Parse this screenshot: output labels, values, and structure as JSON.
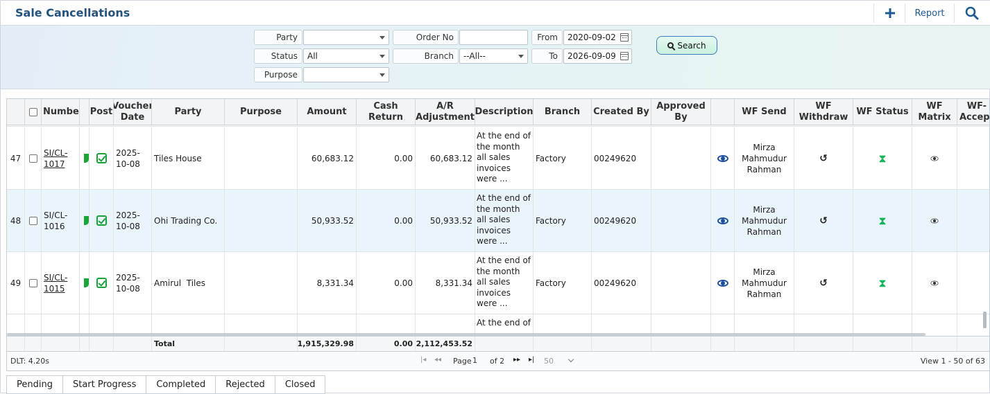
{
  "header": {
    "title": "Sale Cancellations",
    "report_label": "Report"
  },
  "filters": {
    "party_label": "Party",
    "party_value": "",
    "status_label": "Status",
    "status_value": "All",
    "purpose_label": "Purpose",
    "purpose_value": "",
    "order_no_label": "Order No",
    "order_no_value": "",
    "branch_label": "Branch",
    "branch_value": "--All--",
    "from_label": "From",
    "from_value": "2020-09-02",
    "to_label": "To",
    "to_value": "2026-09-09",
    "search_label": "Search"
  },
  "columns": {
    "number": "Number",
    "post": "Post",
    "voucher_date": "Voucher Date",
    "party": "Party",
    "purpose": "Purpose",
    "amount": "Amount",
    "cash_return": "Cash Return",
    "ar_adjustment": "A/R Adjustment",
    "description": "Description",
    "branch": "Branch",
    "created_by": "Created By",
    "approved_by": "Approved By",
    "wf_send": "WF Send",
    "wf_withdraw": "WF Withdraw",
    "wf_status": "WF Status",
    "wf_matrix": "WF Matrix",
    "wf_accept": "WF-Accept"
  },
  "rows": [
    {
      "idx": "47",
      "number": "SI/CL-1017",
      "date": "2025-10-08",
      "party": "Tiles House",
      "purpose": "",
      "amount": "60,683.12",
      "cash_return": "0.00",
      "ar_adjustment": "60,683.12",
      "description": "At the end of the month all sales invoices were ...",
      "branch": "Factory",
      "created_by": "00249620",
      "approved_by": "",
      "wf_send": "Mirza Mahmudur Rahman"
    },
    {
      "idx": "48",
      "number": "SI/CL-1016",
      "date": "2025-10-08",
      "party": "Ohi Trading Co.",
      "purpose": "",
      "amount": "50,933.52",
      "cash_return": "0.00",
      "ar_adjustment": "50,933.52",
      "description": "At the end of the month all sales invoices were ...",
      "branch": "Factory",
      "created_by": "00249620",
      "approved_by": "",
      "wf_send": "Mirza Mahmudur Rahman"
    },
    {
      "idx": "49",
      "number": "SI/CL-1015",
      "date": "2025-10-08",
      "party": "Amirul  Tiles",
      "purpose": "",
      "amount": "8,331.34",
      "cash_return": "0.00",
      "ar_adjustment": "8,331.34",
      "description": "At the end of the month all sales invoices were ...",
      "branch": "Factory",
      "created_by": "00249620",
      "approved_by": "",
      "wf_send": "Mirza Mahmudur Rahman"
    },
    {
      "description": "At the end of"
    }
  ],
  "totals": {
    "label": "Total",
    "amount": "1,915,329.98",
    "cash_return": "0.00",
    "ar_adjustment": "2,112,453.52"
  },
  "pager": {
    "dlt": "DLT: 4.20s",
    "page_label": "Page",
    "page_value": "1",
    "of_label": "of 2",
    "rows_per_page": "50",
    "view_info": "View 1 - 50 of 63"
  },
  "status_tabs": [
    "Pending",
    "Start Progress",
    "Completed",
    "Rejected",
    "Closed"
  ]
}
